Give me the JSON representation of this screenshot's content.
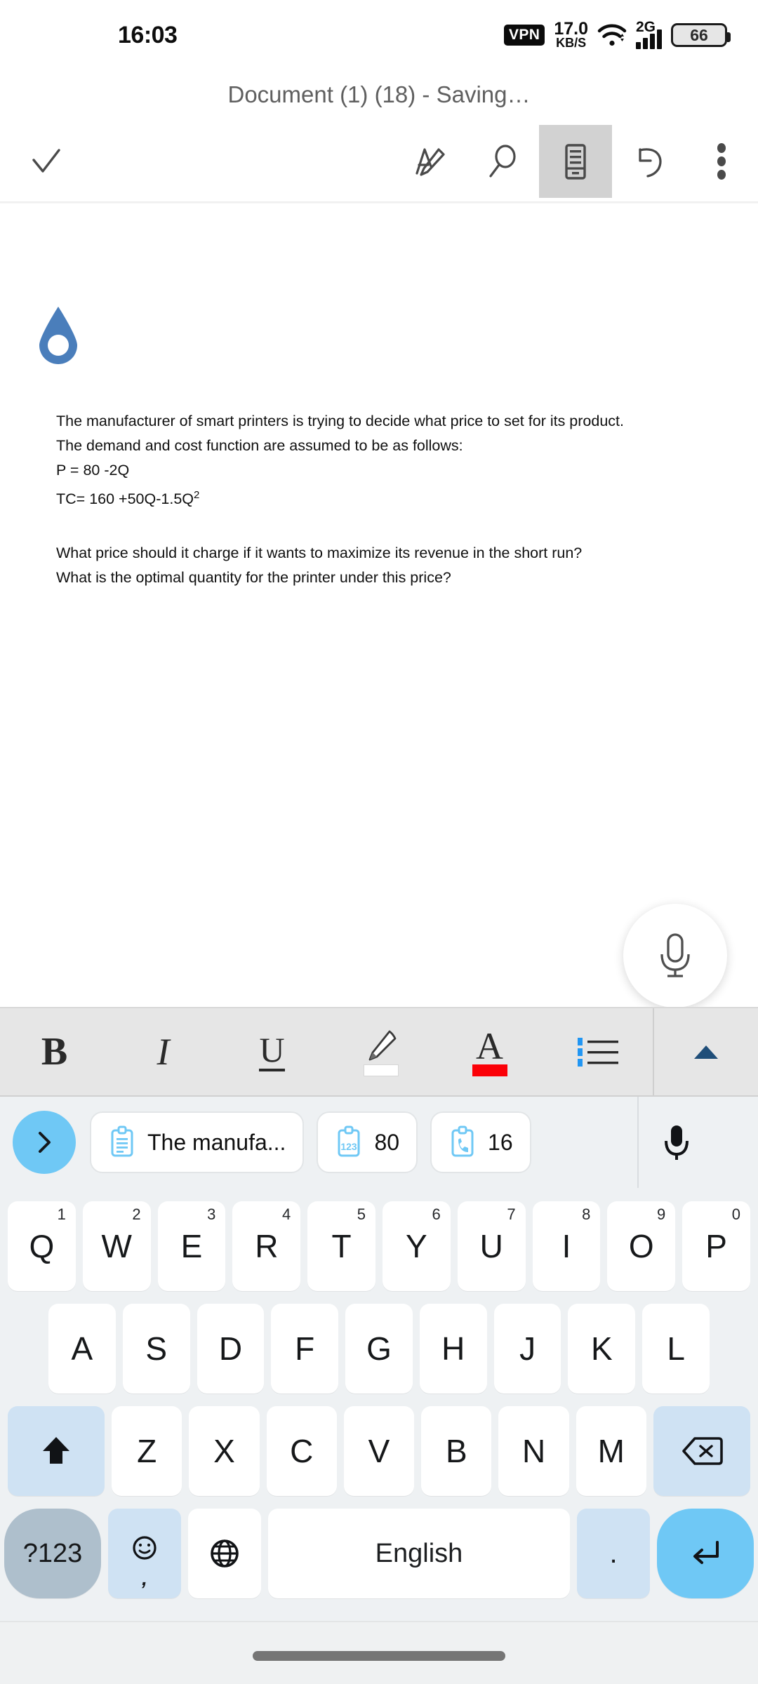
{
  "status_bar": {
    "time": "16:03",
    "vpn_label": "VPN",
    "net_speed_value": "17.0",
    "net_speed_unit": "KB/S",
    "wifi_icon": "wifi-icon",
    "network_type": "2G",
    "battery_percent": "66"
  },
  "document": {
    "title": "Document (1) (18) - Saving…",
    "logo_icon": "water-drop-logo",
    "logo_color": "#4a7ebb",
    "paragraphs": [
      "The manufacturer of smart printers is trying to decide what price to set for its product. The demand and cost function are assumed to be as follows:",
      "P = 80 -2Q",
      "TC= 160 +50Q-1.5Q"
    ],
    "superscript": "2",
    "questions": [
      "What price should it charge if it wants to maximize its revenue in the short run?",
      "What is the optimal quantity for the printer under this price?"
    ]
  },
  "app_toolbar": {
    "done_label": "done-check",
    "items": [
      {
        "name": "done-checkmark-button",
        "icon": "check-icon"
      },
      {
        "name": "edit-pen-button",
        "icon": "pen-edit-icon"
      },
      {
        "name": "search-button",
        "icon": "search-icon"
      },
      {
        "name": "mobile-view-button",
        "icon": "mobile-view-icon",
        "selected": true
      },
      {
        "name": "undo-button",
        "icon": "undo-icon"
      },
      {
        "name": "overflow-menu-button",
        "icon": "more-vertical-icon"
      }
    ]
  },
  "fab": {
    "icon": "microphone-icon"
  },
  "format_bar": {
    "buttons": [
      {
        "name": "bold-button",
        "label": "B"
      },
      {
        "name": "italic-button",
        "label": "I"
      },
      {
        "name": "underline-button",
        "label": "U"
      },
      {
        "name": "highlighter-button",
        "icon": "highlighter-icon",
        "swatch": "#ffffff"
      },
      {
        "name": "font-color-button",
        "label": "A",
        "swatch": "#fb0007"
      },
      {
        "name": "bullet-list-button",
        "icon": "bullet-list-icon",
        "marker_color": "#2196f3"
      }
    ],
    "expander_icon": "chevron-up-icon",
    "expander_color": "#1f4e79"
  },
  "suggestions": {
    "toggle_icon": "chevron-right-icon",
    "chips": [
      {
        "name": "clipboard-text-chip",
        "icon": "clipboard-text-icon",
        "text": "The manufa..."
      },
      {
        "name": "clipboard-number-chip",
        "icon": "clipboard-123-icon",
        "text": "80"
      },
      {
        "name": "clipboard-phone-chip",
        "icon": "clipboard-phone-icon",
        "text": "16"
      }
    ],
    "mic_icon": "microphone-icon"
  },
  "keyboard": {
    "row1": [
      {
        "key": "Q",
        "num": "1"
      },
      {
        "key": "W",
        "num": "2"
      },
      {
        "key": "E",
        "num": "3"
      },
      {
        "key": "R",
        "num": "4"
      },
      {
        "key": "T",
        "num": "5"
      },
      {
        "key": "Y",
        "num": "6"
      },
      {
        "key": "U",
        "num": "7"
      },
      {
        "key": "I",
        "num": "8"
      },
      {
        "key": "O",
        "num": "9"
      },
      {
        "key": "P",
        "num": "0"
      }
    ],
    "row2": [
      {
        "key": "A"
      },
      {
        "key": "S"
      },
      {
        "key": "D"
      },
      {
        "key": "F"
      },
      {
        "key": "G"
      },
      {
        "key": "H"
      },
      {
        "key": "J"
      },
      {
        "key": "K"
      },
      {
        "key": "L"
      }
    ],
    "row3": [
      {
        "key": "Z"
      },
      {
        "key": "X"
      },
      {
        "key": "C"
      },
      {
        "key": "V"
      },
      {
        "key": "B"
      },
      {
        "key": "N"
      },
      {
        "key": "M"
      }
    ],
    "shift_icon": "shift-arrow-icon",
    "backspace_icon": "backspace-icon",
    "symbols_label": "?123",
    "emoji_icon": "emoji-smiley-icon",
    "emoji_sub": ",",
    "globe_icon": "globe-language-icon",
    "space_label": "English",
    "period_label": ".",
    "enter_icon": "enter-return-icon"
  },
  "nav_bar": {
    "pill": "home-gesture-pill"
  }
}
